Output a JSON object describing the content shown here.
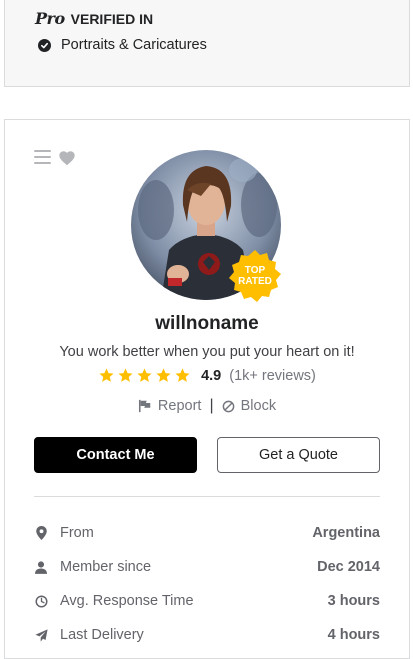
{
  "pro": {
    "logo_text": "Pro",
    "title": "VERIFIED IN",
    "item": "Portraits & Caricatures"
  },
  "profile": {
    "username": "willnoname",
    "tagline": "You work better when you put your heart on it!",
    "badge": {
      "line1": "TOP",
      "line2": "RATED"
    },
    "rating": {
      "stars": 5,
      "score": "4.9",
      "count": "(1k+ reviews)"
    },
    "report_label": "Report",
    "separator": "|",
    "block_label": "Block",
    "contact_label": "Contact Me",
    "quote_label": "Get a Quote"
  },
  "stats": [
    {
      "icon": "location-pin-icon",
      "label": "From",
      "value": "Argentina"
    },
    {
      "icon": "user-icon",
      "label": "Member since",
      "value": "Dec 2014"
    },
    {
      "icon": "clock-icon",
      "label": "Avg. Response Time",
      "value": "3 hours"
    },
    {
      "icon": "paper-plane-icon",
      "label": "Last Delivery",
      "value": "4 hours"
    }
  ],
  "colors": {
    "star": "#ffbe00",
    "badge": "#ffbe00",
    "contact_bg": "#000000"
  }
}
